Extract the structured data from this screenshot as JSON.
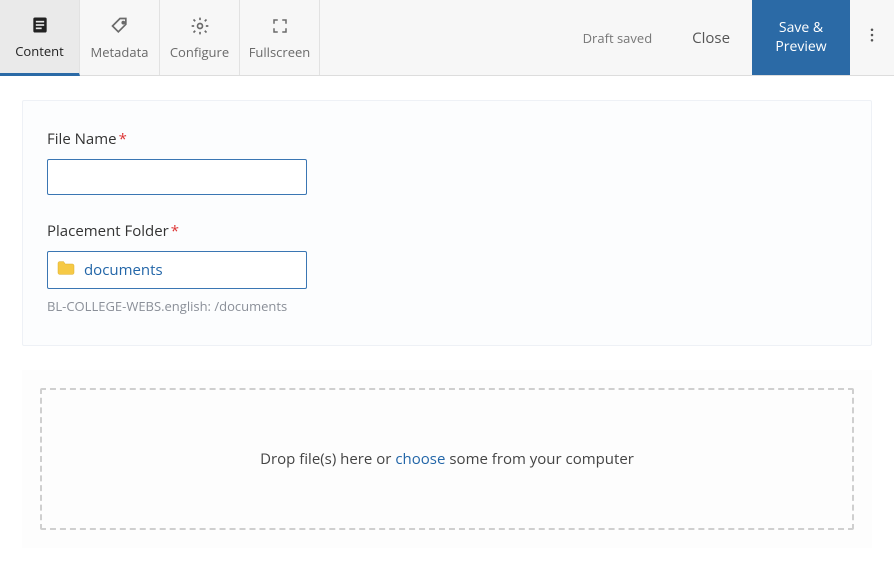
{
  "toolbar": {
    "tabs": {
      "content": "Content",
      "metadata": "Metadata",
      "configure": "Configure",
      "fullscreen": "Fullscreen"
    },
    "status": "Draft saved",
    "close_label": "Close",
    "primary_label": "Save & Preview"
  },
  "form": {
    "file_name": {
      "label": "File Name",
      "value": "",
      "required": true
    },
    "placement_folder": {
      "label": "Placement Folder",
      "value": "documents",
      "required": true,
      "path_hint": "BL-COLLEGE-WEBS.english: /documents"
    }
  },
  "dropzone": {
    "prefix": "Drop file(s) here or",
    "choose": "choose",
    "suffix": "some from your computer"
  }
}
